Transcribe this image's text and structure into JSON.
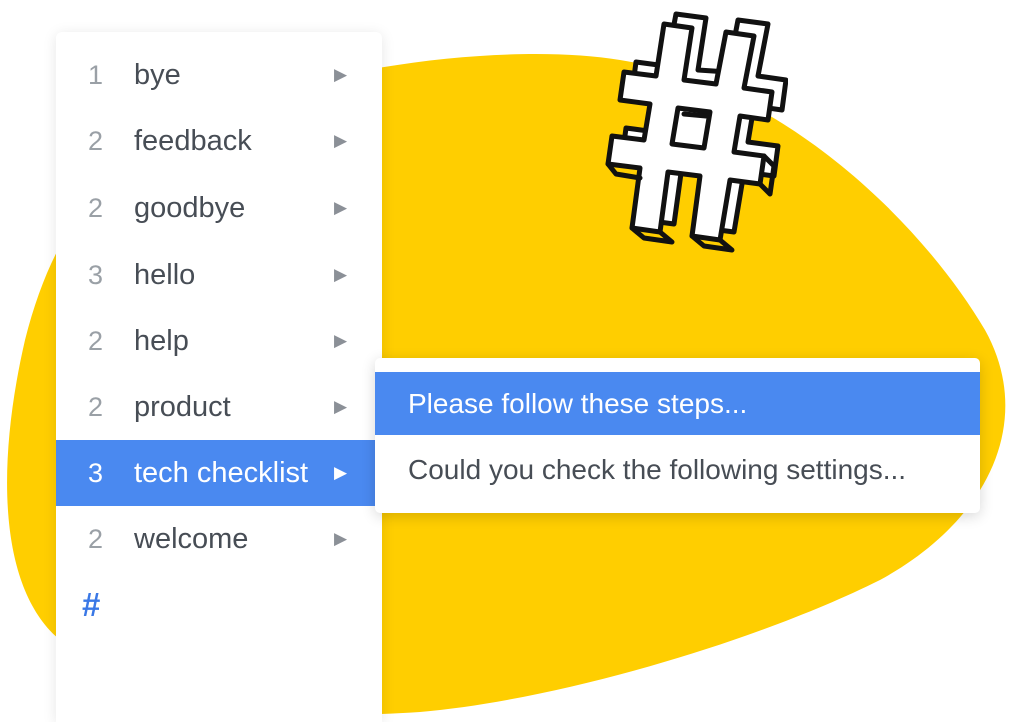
{
  "colors": {
    "accent_blue": "#4a89f0",
    "blob_yellow": "#ffce00",
    "text": "#474d55",
    "muted": "#9aa0a6"
  },
  "menu": {
    "items": [
      {
        "count": "1",
        "label": "bye",
        "arrow": "▶"
      },
      {
        "count": "2",
        "label": "feedback",
        "arrow": "▶"
      },
      {
        "count": "2",
        "label": "goodbye",
        "arrow": "▶"
      },
      {
        "count": "3",
        "label": "hello",
        "arrow": "▶"
      },
      {
        "count": "2",
        "label": "help",
        "arrow": "▶"
      },
      {
        "count": "2",
        "label": "product",
        "arrow": "▶"
      },
      {
        "count": "3",
        "label": "tech checklist",
        "arrow": "▶",
        "selected": true
      },
      {
        "count": "2",
        "label": "welcome",
        "arrow": "▶"
      }
    ],
    "footer_symbol": "#",
    "footer_icon": "hashtag-icon"
  },
  "submenu": {
    "items": [
      {
        "text": "Please follow these steps...",
        "highlighted": true
      },
      {
        "text": "Could you check the following settings..."
      }
    ]
  },
  "decoration": {
    "hash_art_icon": "hashtag-illustration-icon"
  }
}
